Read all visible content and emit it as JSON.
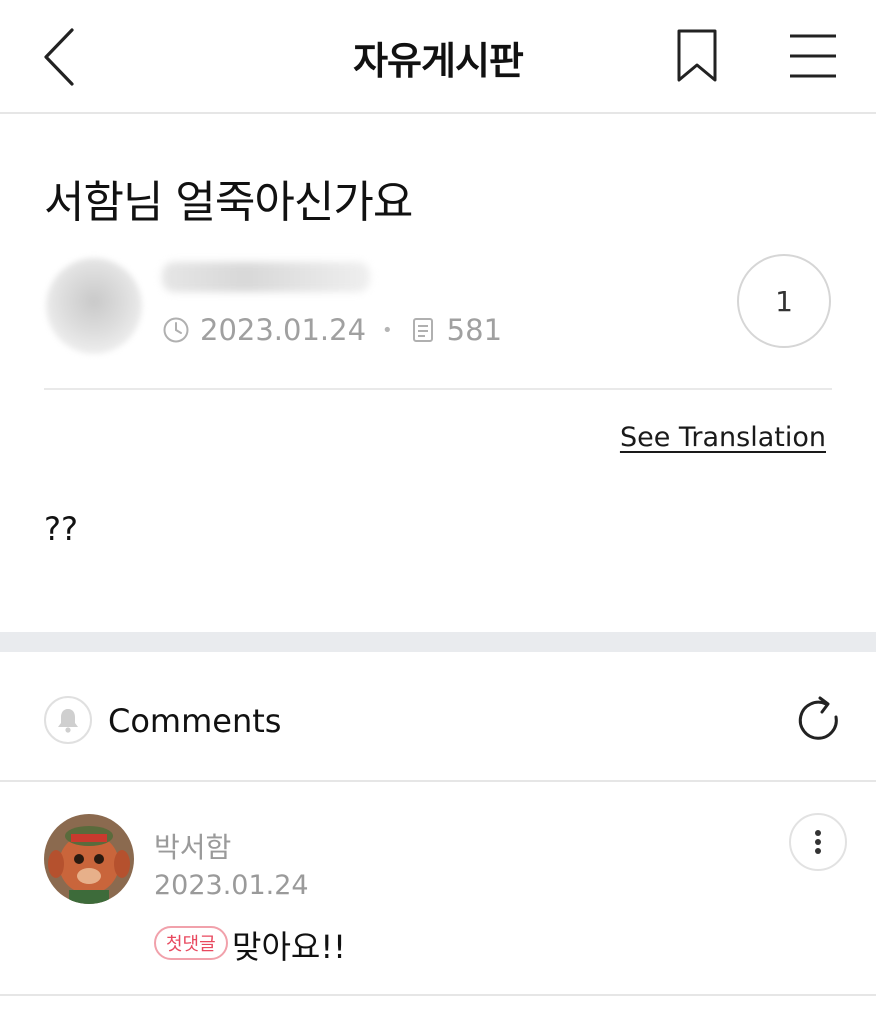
{
  "header": {
    "title": "자유게시판",
    "back_icon": "chevron-left-icon",
    "bookmark_icon": "bookmark-icon",
    "menu_icon": "hamburger-menu-icon"
  },
  "post": {
    "title": "서함님 얼죽아신가요",
    "date": "2023.01.24",
    "views": "581",
    "like_count": "1",
    "see_translation": "See Translation",
    "body": "??"
  },
  "comments": {
    "label": "Comments",
    "bell_icon": "bell-icon",
    "refresh_icon": "refresh-icon",
    "items": [
      {
        "author": "박서함",
        "date": "2023.01.24",
        "badge": "첫댓글",
        "text": "맞아요!!"
      }
    ]
  },
  "colors": {
    "badge": "#e8495f",
    "meta_text": "#a0a0a0",
    "section_gap": "#e9ebee"
  }
}
